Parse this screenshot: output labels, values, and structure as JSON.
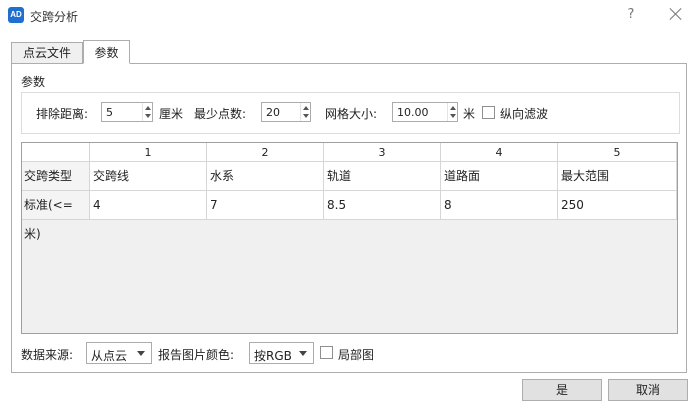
{
  "window": {
    "app_icon_text": "AD",
    "title": "交跨分析",
    "help_glyph": "?"
  },
  "tabs": [
    {
      "label": "点云文件",
      "active": false
    },
    {
      "label": "参数",
      "active": true
    }
  ],
  "params": {
    "group_title": "参数",
    "exclude_distance_label": "排除距离:",
    "exclude_distance_value": "5",
    "exclude_distance_unit": "厘米",
    "min_points_label": "最少点数:",
    "min_points_value": "20",
    "grid_size_label": "网格大小:",
    "grid_size_value": "10.00",
    "grid_size_unit": "米",
    "vertical_filter_label": "纵向滤波",
    "vertical_filter_checked": false
  },
  "table": {
    "column_headers": [
      "1",
      "2",
      "3",
      "4",
      "5"
    ],
    "rows": [
      {
        "header": "交跨类型",
        "cells": [
          "交跨线",
          "水系",
          "轨道",
          "道路面",
          "最大范围"
        ]
      },
      {
        "header": "标准(<=米)",
        "cells": [
          "4",
          "7",
          "8.5",
          "8",
          "250"
        ]
      }
    ]
  },
  "footer": {
    "data_source_label": "数据来源:",
    "data_source_value": "从点云",
    "report_color_label": "报告图片颜色:",
    "report_color_value": "按RGB",
    "local_map_label": "局部图",
    "local_map_checked": false
  },
  "buttons": {
    "ok": "是",
    "cancel": "取消"
  }
}
